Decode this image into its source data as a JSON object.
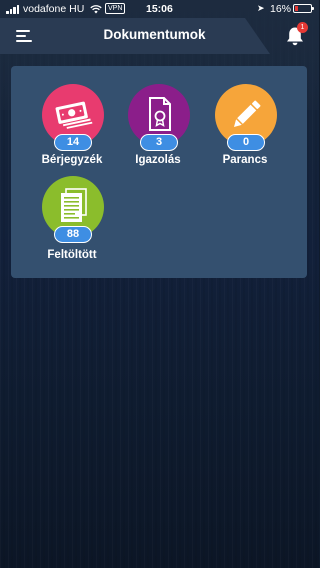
{
  "status_bar": {
    "carrier": "vodafone HU",
    "vpn": "VPN",
    "time": "15:06",
    "battery": "16%",
    "battery_level": 0.16
  },
  "header": {
    "title": "Dokumentumok",
    "notification_count": "1"
  },
  "tiles": [
    {
      "label": "Bérjegyzék",
      "count": "14",
      "color": "#e83b6f",
      "icon": "money-icon"
    },
    {
      "label": "Igazolás",
      "count": "3",
      "color": "#8b1e8a",
      "icon": "certificate-icon"
    },
    {
      "label": "Parancs",
      "count": "0",
      "color": "#f6a53a",
      "icon": "pencil-icon"
    },
    {
      "label": "Feltöltött",
      "count": "88",
      "color": "#8bbd2c",
      "icon": "document-icon"
    }
  ],
  "colors": {
    "panel": "#34506f",
    "badge": "#3e8ee3",
    "notification": "#e53935"
  }
}
